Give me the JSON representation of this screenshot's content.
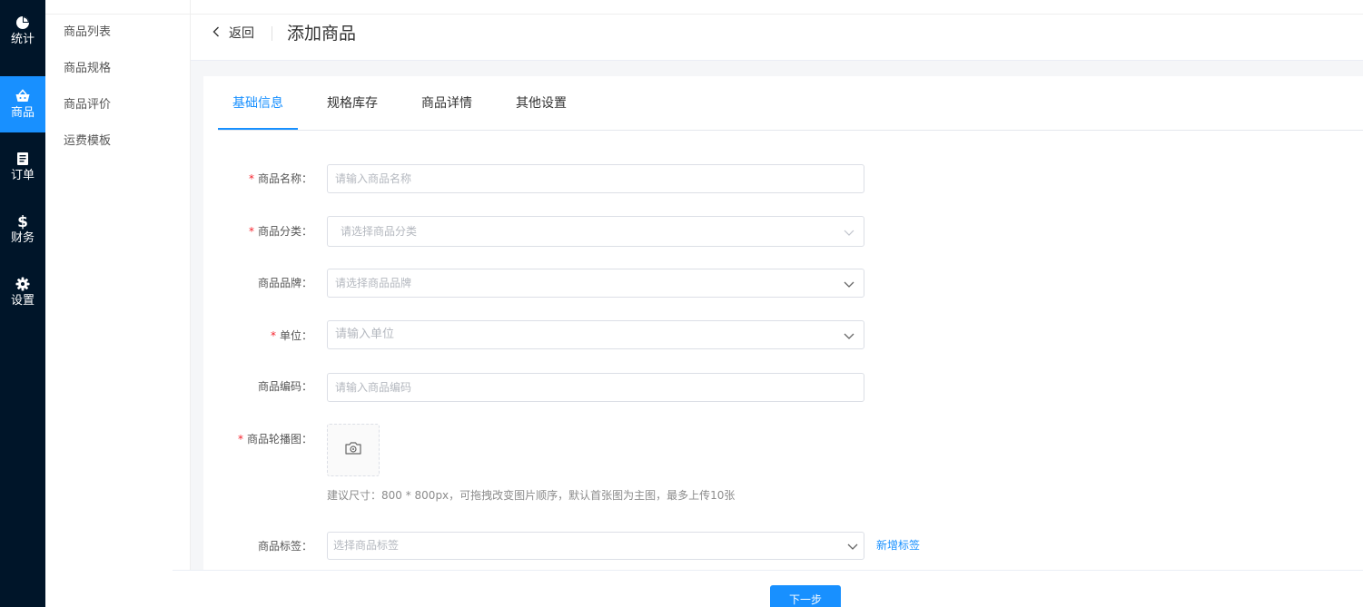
{
  "primary_nav": {
    "items": [
      {
        "label": "统计",
        "icon": "pie-chart-icon"
      },
      {
        "label": "商品",
        "icon": "basket-icon"
      },
      {
        "label": "订单",
        "icon": "document-icon"
      },
      {
        "label": "财务",
        "icon": "dollar-icon"
      },
      {
        "label": "设置",
        "icon": "gear-icon"
      }
    ],
    "active": "商品"
  },
  "secondary_nav": {
    "items": [
      "商品列表",
      "商品规格",
      "商品评价",
      "运费模板"
    ]
  },
  "header": {
    "back_label": "返回",
    "title": "添加商品"
  },
  "tabs": [
    {
      "label": "基础信息",
      "active": true
    },
    {
      "label": "规格库存",
      "active": false
    },
    {
      "label": "商品详情",
      "active": false
    },
    {
      "label": "其他设置",
      "active": false
    }
  ],
  "form": {
    "name": {
      "label": "商品名称：",
      "required": true,
      "placeholder": "请输入商品名称",
      "value": ""
    },
    "category": {
      "label": "商品分类：",
      "required": true,
      "placeholder": "请选择商品分类"
    },
    "brand": {
      "label": "商品品牌：",
      "required": false,
      "placeholder": "请选择商品品牌"
    },
    "unit": {
      "label": "单位：",
      "required": true,
      "placeholder": "请输入单位"
    },
    "code": {
      "label": "商品编码：",
      "required": false,
      "placeholder": "请输入商品编码",
      "value": ""
    },
    "carousel": {
      "label": "商品轮播图：",
      "required": true,
      "hint": "建议尺寸：800 * 800px，可拖拽改变图片顺序，默认首张图为主图，最多上传10张"
    },
    "tags": {
      "label": "商品标签：",
      "required": false,
      "placeholder": "选择商品标签",
      "add_link": "新增标签"
    },
    "required_mark": "*"
  },
  "footer": {
    "next_label": "下一步"
  },
  "colors": {
    "nav_bg": "#001529",
    "accent": "#1890ff",
    "required": "#f5222d"
  }
}
